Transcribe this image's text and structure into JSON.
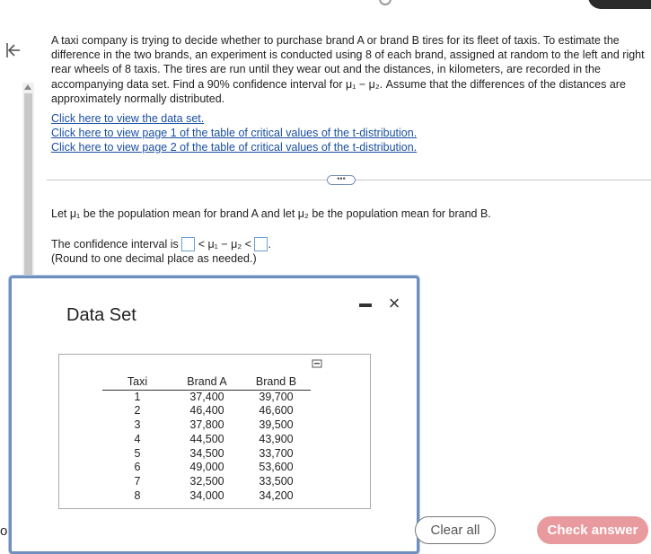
{
  "question": {
    "text": "A taxi company is trying to decide whether to purchase brand A or brand B tires for its fleet of taxis. To estimate the difference in the two brands, an experiment is conducted using 8 of each brand, assigned at random to the left and right rear wheels of 8 taxis. The tires are run until they wear out and the distances, in kilometers, are recorded in the accompanying data set. Find a 90% confidence interval for μ₁ − μ₂. Assume that the differences of the distances are approximately normally distributed.",
    "links": [
      "Click here to view the data set.",
      "Click here to view page 1 of the table of critical values of the t-distribution.",
      "Click here to view page 2 of the table of critical values of the t-distribution."
    ]
  },
  "more_button": "•••",
  "answer": {
    "definition": "Let μ₁ be the population mean for brand A and let μ₂ be the population mean for brand B.",
    "interval_prefix": "The confidence interval is",
    "interval_middle": " < μ₁ − μ₂ < ",
    "interval_suffix": ".",
    "round_note": "(Round to one decimal place as needed.)"
  },
  "modal": {
    "title": "Data Set",
    "table": {
      "headers": [
        "Taxi",
        "Brand A",
        "Brand B"
      ],
      "rows": [
        [
          "1",
          "37,400",
          "39,700"
        ],
        [
          "2",
          "46,400",
          "46,600"
        ],
        [
          "3",
          "37,800",
          "39,500"
        ],
        [
          "4",
          "44,500",
          "43,900"
        ],
        [
          "5",
          "34,500",
          "33,700"
        ],
        [
          "6",
          "49,000",
          "53,600"
        ],
        [
          "7",
          "32,500",
          "33,500"
        ],
        [
          "8",
          "34,000",
          "34,200"
        ]
      ]
    },
    "close_label": "×"
  },
  "buttons": {
    "clear": "Clear all",
    "check": "Check answer"
  },
  "left_edge_char": "o",
  "colors": {
    "link": "#1a4fa0",
    "modal_border": "#6f8fbf",
    "check_button": "#e89a9e",
    "input_border": "#6a9fd8"
  }
}
